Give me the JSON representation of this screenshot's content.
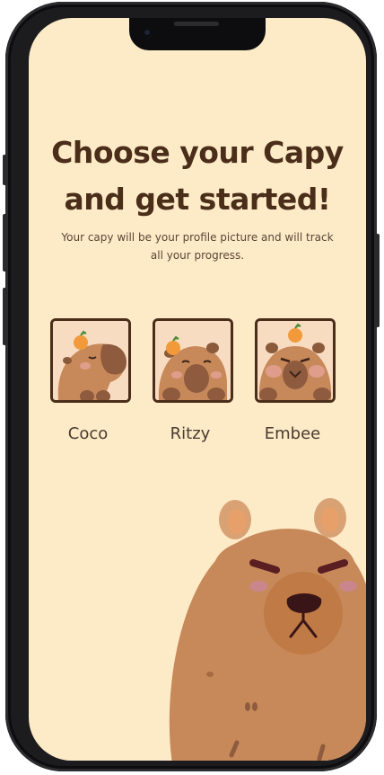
{
  "screen": {
    "title": "Choose your Capy and get started!",
    "subtitle": "Your capy will be your profile picture and will track all your progress."
  },
  "capies": [
    {
      "name": "Coco",
      "icon": "capybara-sleeping-icon"
    },
    {
      "name": "Ritzy",
      "icon": "capybara-pouting-icon"
    },
    {
      "name": "Embee",
      "icon": "capybara-grumpy-icon"
    }
  ],
  "colors": {
    "background": "#fdebc8",
    "text_dark": "#4a2e1a",
    "capy_fur": "#c8895a",
    "orange": "#f29a3a"
  }
}
